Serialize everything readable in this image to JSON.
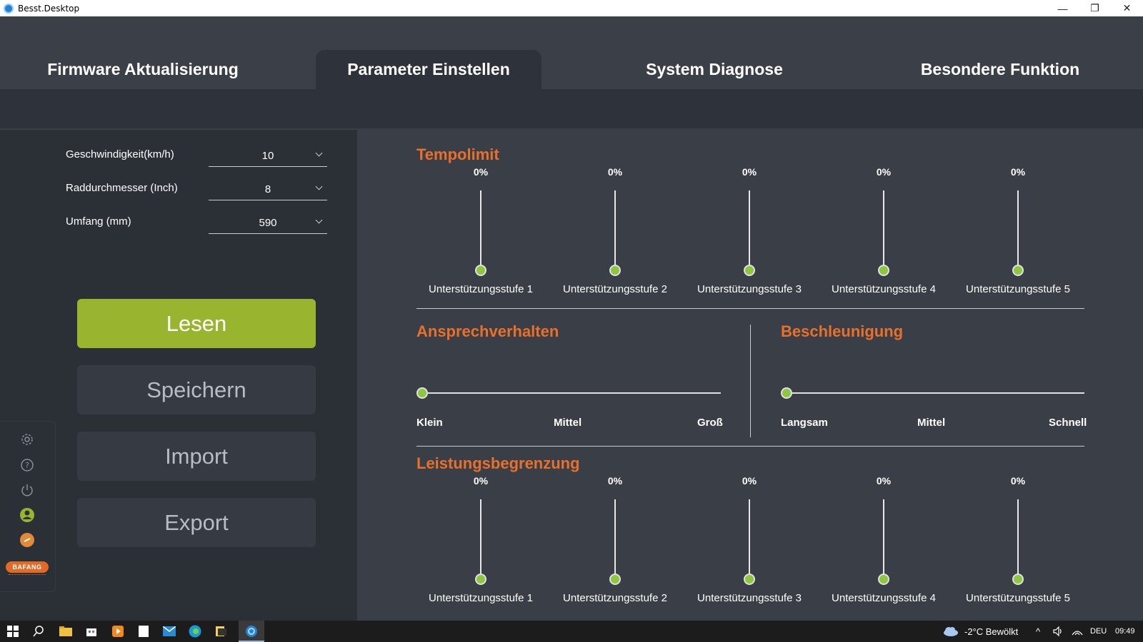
{
  "window": {
    "title": "Besst.Desktop",
    "minimize": "—",
    "restore": "❐",
    "close": "✕"
  },
  "tabs": [
    {
      "label": "Firmware Aktualisierung"
    },
    {
      "label": "Parameter Einstellen"
    },
    {
      "label": "System Diagnose"
    },
    {
      "label": "Besondere Funktion"
    }
  ],
  "settings": {
    "speed": {
      "label": "Geschwindigkeit(km/h)",
      "value": "10"
    },
    "wheel": {
      "label": "Raddurchmesser (Inch)",
      "value": "8"
    },
    "circumference": {
      "label": "Umfang (mm)",
      "value": "590"
    }
  },
  "actions": {
    "read": "Lesen",
    "save": "Speichern",
    "import": "Import",
    "export": "Export"
  },
  "sidebar": {
    "icons": [
      "gear-icon",
      "help-icon",
      "power-icon",
      "user-icon",
      "link-icon"
    ],
    "logo_text": "BAFANG"
  },
  "tempolimit": {
    "title": "Tempolimit",
    "levels": [
      {
        "label": "Unterstützungsstufe 1",
        "value": "0%"
      },
      {
        "label": "Unterstützungsstufe 2",
        "value": "0%"
      },
      {
        "label": "Unterstützungsstufe 3",
        "value": "0%"
      },
      {
        "label": "Unterstützungsstufe 4",
        "value": "0%"
      },
      {
        "label": "Unterstützungsstufe 5",
        "value": "0%"
      }
    ]
  },
  "ansprechverhalten": {
    "title": "Ansprechverhalten",
    "labels": [
      "Klein",
      "Mittel",
      "Groß"
    ]
  },
  "beschleunigung": {
    "title": "Beschleunigung",
    "labels": [
      "Langsam",
      "Mittel",
      "Schnell"
    ]
  },
  "leistungsbegrenzung": {
    "title": "Leistungsbegrenzung",
    "levels": [
      {
        "label": "Unterstützungsstufe 1",
        "value": "0%"
      },
      {
        "label": "Unterstützungsstufe 2",
        "value": "0%"
      },
      {
        "label": "Unterstützungsstufe 3",
        "value": "0%"
      },
      {
        "label": "Unterstützungsstufe 4",
        "value": "0%"
      },
      {
        "label": "Unterstützungsstufe 5",
        "value": "0%"
      }
    ]
  },
  "taskbar": {
    "weather": "-2°C  Bewölkt",
    "language": "DEU",
    "time": "09:49"
  }
}
